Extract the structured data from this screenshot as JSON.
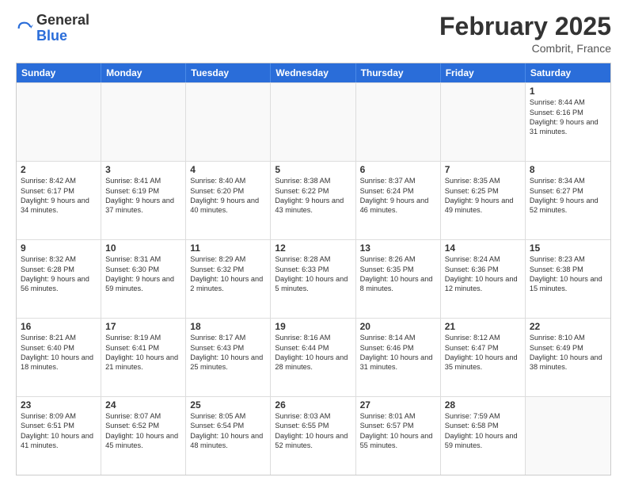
{
  "logo": {
    "general": "General",
    "blue": "Blue"
  },
  "header": {
    "month": "February 2025",
    "location": "Combrit, France"
  },
  "days": [
    "Sunday",
    "Monday",
    "Tuesday",
    "Wednesday",
    "Thursday",
    "Friday",
    "Saturday"
  ],
  "weeks": [
    [
      {
        "day": "",
        "empty": true
      },
      {
        "day": "",
        "empty": true
      },
      {
        "day": "",
        "empty": true
      },
      {
        "day": "",
        "empty": true
      },
      {
        "day": "",
        "empty": true
      },
      {
        "day": "",
        "empty": true
      },
      {
        "day": "1",
        "rise": "Sunrise: 8:44 AM",
        "set": "Sunset: 6:16 PM",
        "daylight": "Daylight: 9 hours and 31 minutes."
      }
    ],
    [
      {
        "day": "2",
        "rise": "Sunrise: 8:42 AM",
        "set": "Sunset: 6:17 PM",
        "daylight": "Daylight: 9 hours and 34 minutes."
      },
      {
        "day": "3",
        "rise": "Sunrise: 8:41 AM",
        "set": "Sunset: 6:19 PM",
        "daylight": "Daylight: 9 hours and 37 minutes."
      },
      {
        "day": "4",
        "rise": "Sunrise: 8:40 AM",
        "set": "Sunset: 6:20 PM",
        "daylight": "Daylight: 9 hours and 40 minutes."
      },
      {
        "day": "5",
        "rise": "Sunrise: 8:38 AM",
        "set": "Sunset: 6:22 PM",
        "daylight": "Daylight: 9 hours and 43 minutes."
      },
      {
        "day": "6",
        "rise": "Sunrise: 8:37 AM",
        "set": "Sunset: 6:24 PM",
        "daylight": "Daylight: 9 hours and 46 minutes."
      },
      {
        "day": "7",
        "rise": "Sunrise: 8:35 AM",
        "set": "Sunset: 6:25 PM",
        "daylight": "Daylight: 9 hours and 49 minutes."
      },
      {
        "day": "8",
        "rise": "Sunrise: 8:34 AM",
        "set": "Sunset: 6:27 PM",
        "daylight": "Daylight: 9 hours and 52 minutes."
      }
    ],
    [
      {
        "day": "9",
        "rise": "Sunrise: 8:32 AM",
        "set": "Sunset: 6:28 PM",
        "daylight": "Daylight: 9 hours and 56 minutes."
      },
      {
        "day": "10",
        "rise": "Sunrise: 8:31 AM",
        "set": "Sunset: 6:30 PM",
        "daylight": "Daylight: 9 hours and 59 minutes."
      },
      {
        "day": "11",
        "rise": "Sunrise: 8:29 AM",
        "set": "Sunset: 6:32 PM",
        "daylight": "Daylight: 10 hours and 2 minutes."
      },
      {
        "day": "12",
        "rise": "Sunrise: 8:28 AM",
        "set": "Sunset: 6:33 PM",
        "daylight": "Daylight: 10 hours and 5 minutes."
      },
      {
        "day": "13",
        "rise": "Sunrise: 8:26 AM",
        "set": "Sunset: 6:35 PM",
        "daylight": "Daylight: 10 hours and 8 minutes."
      },
      {
        "day": "14",
        "rise": "Sunrise: 8:24 AM",
        "set": "Sunset: 6:36 PM",
        "daylight": "Daylight: 10 hours and 12 minutes."
      },
      {
        "day": "15",
        "rise": "Sunrise: 8:23 AM",
        "set": "Sunset: 6:38 PM",
        "daylight": "Daylight: 10 hours and 15 minutes."
      }
    ],
    [
      {
        "day": "16",
        "rise": "Sunrise: 8:21 AM",
        "set": "Sunset: 6:40 PM",
        "daylight": "Daylight: 10 hours and 18 minutes."
      },
      {
        "day": "17",
        "rise": "Sunrise: 8:19 AM",
        "set": "Sunset: 6:41 PM",
        "daylight": "Daylight: 10 hours and 21 minutes."
      },
      {
        "day": "18",
        "rise": "Sunrise: 8:17 AM",
        "set": "Sunset: 6:43 PM",
        "daylight": "Daylight: 10 hours and 25 minutes."
      },
      {
        "day": "19",
        "rise": "Sunrise: 8:16 AM",
        "set": "Sunset: 6:44 PM",
        "daylight": "Daylight: 10 hours and 28 minutes."
      },
      {
        "day": "20",
        "rise": "Sunrise: 8:14 AM",
        "set": "Sunset: 6:46 PM",
        "daylight": "Daylight: 10 hours and 31 minutes."
      },
      {
        "day": "21",
        "rise": "Sunrise: 8:12 AM",
        "set": "Sunset: 6:47 PM",
        "daylight": "Daylight: 10 hours and 35 minutes."
      },
      {
        "day": "22",
        "rise": "Sunrise: 8:10 AM",
        "set": "Sunset: 6:49 PM",
        "daylight": "Daylight: 10 hours and 38 minutes."
      }
    ],
    [
      {
        "day": "23",
        "rise": "Sunrise: 8:09 AM",
        "set": "Sunset: 6:51 PM",
        "daylight": "Daylight: 10 hours and 41 minutes."
      },
      {
        "day": "24",
        "rise": "Sunrise: 8:07 AM",
        "set": "Sunset: 6:52 PM",
        "daylight": "Daylight: 10 hours and 45 minutes."
      },
      {
        "day": "25",
        "rise": "Sunrise: 8:05 AM",
        "set": "Sunset: 6:54 PM",
        "daylight": "Daylight: 10 hours and 48 minutes."
      },
      {
        "day": "26",
        "rise": "Sunrise: 8:03 AM",
        "set": "Sunset: 6:55 PM",
        "daylight": "Daylight: 10 hours and 52 minutes."
      },
      {
        "day": "27",
        "rise": "Sunrise: 8:01 AM",
        "set": "Sunset: 6:57 PM",
        "daylight": "Daylight: 10 hours and 55 minutes."
      },
      {
        "day": "28",
        "rise": "Sunrise: 7:59 AM",
        "set": "Sunset: 6:58 PM",
        "daylight": "Daylight: 10 hours and 59 minutes."
      },
      {
        "day": "",
        "empty": true
      }
    ]
  ]
}
